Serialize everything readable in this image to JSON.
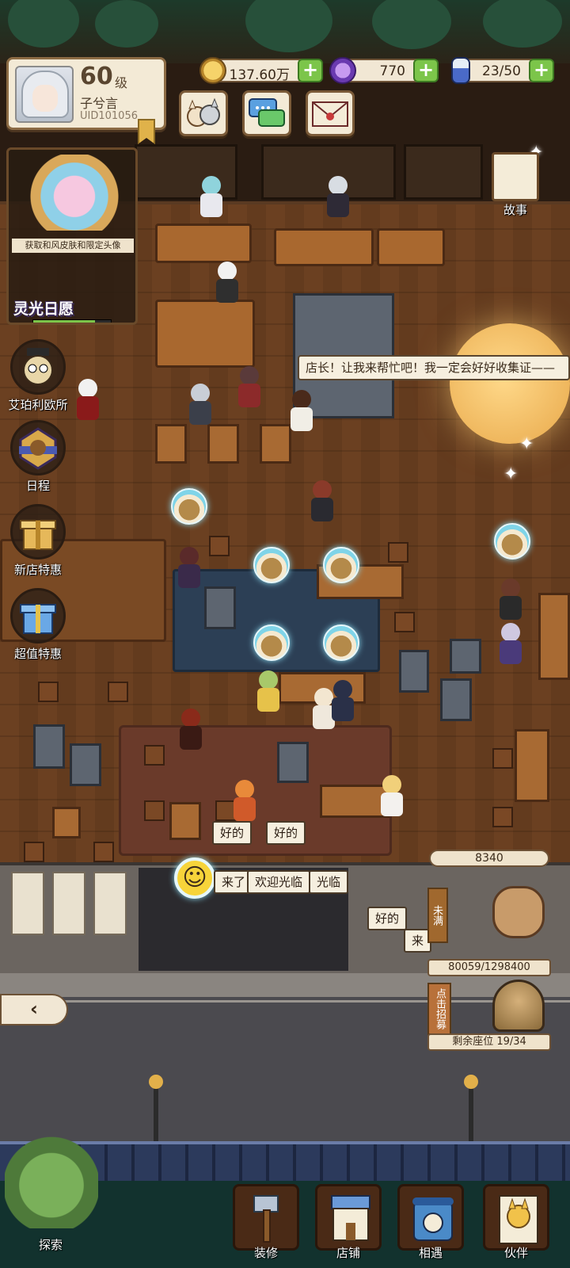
{
  "player": {
    "level": "60",
    "level_suffix": "级",
    "name": "子兮言",
    "uid": "UID101056"
  },
  "resources": {
    "coins": {
      "value": "137.60万",
      "icon": "coin-icon"
    },
    "gems": {
      "value": "770",
      "icon": "purple-gem-icon"
    },
    "stamina": {
      "value": "23/50",
      "icon": "potion-bottle-icon"
    },
    "plus": "+"
  },
  "event": {
    "banner_text": "获取和风皮肤和限定头像",
    "title": "灵光日愿",
    "progress": 0.8
  },
  "side_menu": [
    {
      "label": "艾珀利欧所",
      "icon": "owl-detective-icon"
    },
    {
      "label": "日程",
      "icon": "schedule-badge-icon"
    },
    {
      "label": "新店特惠",
      "icon": "gift-box-icon"
    },
    {
      "label": "超值特惠",
      "icon": "blue-gift-box-icon"
    }
  ],
  "story": {
    "label": "故事"
  },
  "npc_speech": "店长！让我来帮忙吧！我一定会好好收集证——",
  "bubbles": {
    "ok1": "好的",
    "ok2": "好的",
    "coming": "来了",
    "welcome1": "欢迎光临",
    "welcome2": "光临",
    "ok3": "好的",
    "coming2": "来"
  },
  "recruit": {
    "score": "8340",
    "status": "未满",
    "collected": "80059/1298400",
    "button": "点击招募",
    "seats": "剩余座位 19/34"
  },
  "back_arrow": "‹",
  "bottom_nav": [
    {
      "label": "探索",
      "icon": "explore-map-icon"
    },
    {
      "label": "装修",
      "icon": "hammer-icon"
    },
    {
      "label": "店铺",
      "icon": "shop-icon"
    },
    {
      "label": "相遇",
      "icon": "telephone-icon"
    },
    {
      "label": "伙伴",
      "icon": "cat-card-icon"
    }
  ],
  "colors": {
    "floor": "#6b4021",
    "accent_green": "#7cc54a",
    "panel": "#f3ead6"
  }
}
